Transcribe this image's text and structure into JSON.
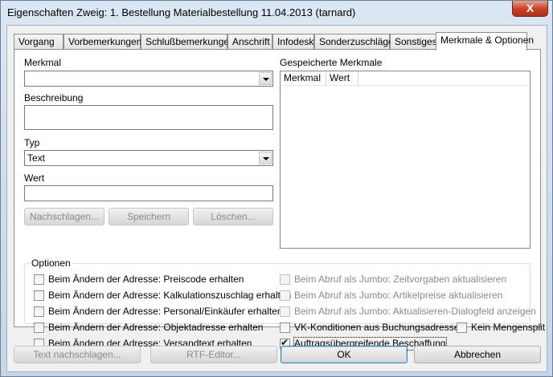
{
  "window": {
    "title": "Eigenschaften Zweig: 1. Bestellung Materialbestellung 11.04.2013 (tarnard)",
    "close_label": "X"
  },
  "tabs": [
    {
      "label": "Vorgang"
    },
    {
      "label": "Vorbemerkungen"
    },
    {
      "label": "Schlußbemerkungen"
    },
    {
      "label": "Anschrift"
    },
    {
      "label": "Infodesk"
    },
    {
      "label": "Sonderzuschläge"
    },
    {
      "label": "Sonstiges"
    },
    {
      "label": "Merkmale & Optionen",
      "active": true
    }
  ],
  "form": {
    "merkmal_label": "Merkmal",
    "merkmal_value": "",
    "beschreibung_label": "Beschreibung",
    "beschreibung_value": "",
    "typ_label": "Typ",
    "typ_value": "Text",
    "wert_label": "Wert",
    "wert_value": "",
    "btn_nachschlagen": "Nachschlagen...",
    "btn_speichern": "Speichern",
    "btn_loeschen": "Löschen..."
  },
  "saved": {
    "label": "Gespeicherte Merkmale",
    "columns": [
      "Merkmal",
      "Wert"
    ]
  },
  "options": {
    "title": "Optionen",
    "left": [
      {
        "label": "Beim Ändern der Adresse: Preiscode erhalten",
        "checked": false
      },
      {
        "label": "Beim Ändern der Adresse: Kalkulationszuschlag erhalten",
        "checked": false
      },
      {
        "label": "Beim Ändern der Adresse: Personal/Einkäufer erhalten",
        "checked": false
      },
      {
        "label": "Beim Ändern der Adresse: Objektadresse erhalten",
        "checked": false
      },
      {
        "label": "Beim Ändern der Adresse: Versandtext erhalten",
        "checked": false
      }
    ],
    "right": [
      {
        "label": "Beim Abruf als Jumbo: Zeitvorgaben aktualisieren",
        "checked": false,
        "disabled": true
      },
      {
        "label": "Beim Abruf als Jumbo: Artikelpreise aktualisieren",
        "checked": false,
        "disabled": true
      },
      {
        "label": "Beim Abruf als Jumbo: Aktualisieren-Dialogfeld anzeigen",
        "checked": false,
        "disabled": true
      },
      {
        "label": "VK-Konditionen aus Buchungsadresse",
        "checked": false,
        "disabled": false
      },
      {
        "label": "Auftragsübergreifende Beschaffung",
        "checked": true,
        "disabled": false
      }
    ],
    "kein_mengensplit": {
      "label": "Kein Mengensplit",
      "checked": false
    }
  },
  "footer": {
    "btn_text_nachschlagen": "Text nachschlagen...",
    "btn_rtf_editor": "RTF-Editor...",
    "btn_ok": "OK",
    "btn_abbrechen": "Abbrechen"
  }
}
